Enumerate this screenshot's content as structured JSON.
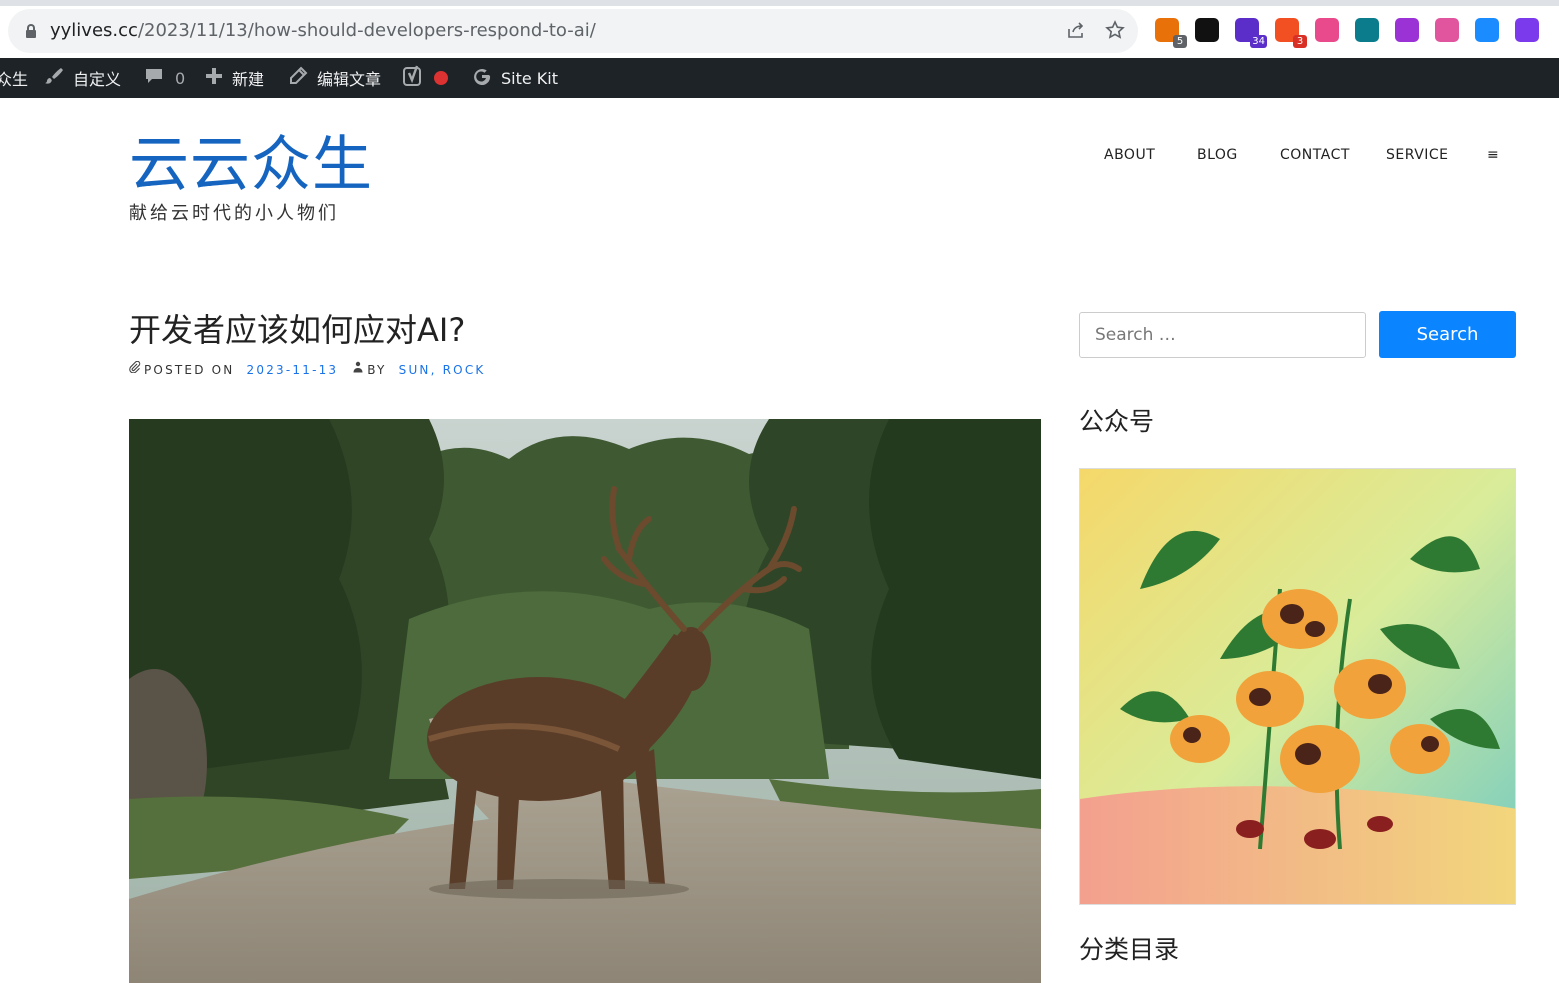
{
  "browser": {
    "url_host": "yylives.cc",
    "url_path": "/2023/11/13/how-should-developers-respond-to-ai/",
    "extensions": [
      {
        "name": "chrome-ext-1-icon",
        "badge": "5",
        "color": "#e8710a",
        "badge_color": "#5f6368"
      },
      {
        "name": "notion-icon",
        "badge": "",
        "color": "#111111",
        "badge_color": ""
      },
      {
        "name": "graduation-cap-icon",
        "badge": "34",
        "color": "#5b2ec9",
        "badge_color": "#5b2ec9"
      },
      {
        "name": "chrome-ext-4-icon",
        "badge": "3",
        "color": "#f25022",
        "badge_color": "#d93025"
      },
      {
        "name": "translate-icon",
        "badge": "",
        "color": "#e84a8b",
        "badge_color": ""
      },
      {
        "name": "chrome-ext-6-icon",
        "badge": "",
        "color": "#0a7c8c",
        "badge_color": ""
      },
      {
        "name": "chrome-ext-7-icon",
        "badge": "",
        "color": "#9b32d6",
        "badge_color": ""
      },
      {
        "name": "chrome-ext-8-icon",
        "badge": "",
        "color": "#e0559d",
        "badge_color": ""
      },
      {
        "name": "chrome-ext-9-icon",
        "badge": "",
        "color": "#1a8cff",
        "badge_color": ""
      },
      {
        "name": "openai-icon",
        "badge": "",
        "color": "#7c3aed",
        "badge_color": ""
      }
    ]
  },
  "adminbar": {
    "site_name": "众生",
    "customize": "自定义",
    "comments_count": "0",
    "new": "新建",
    "edit_post": "编辑文章",
    "site_kit": "Site Kit"
  },
  "site": {
    "title": "云云众生",
    "description": "献给云时代的小人物们"
  },
  "nav": {
    "items": [
      "ABOUT",
      "BLOG",
      "CONTACT",
      "SERVICE"
    ],
    "menu_toggle": "≡"
  },
  "post": {
    "title": "开发者应该如何应对AI?",
    "posted_on_label": "POSTED ON",
    "date": "2023-11-13",
    "by_label": "BY",
    "author": "SUN, ROCK",
    "featured_image": "elk-standing-on-dirt-road-forest"
  },
  "sidebar": {
    "search_placeholder": "Search …",
    "search_button": "Search",
    "widget1_title": "公众号",
    "widget1_image": "cartoon-ants-and-plants-illustration",
    "widget2_title": "分类目录"
  },
  "colors": {
    "accent": "#1565c0",
    "link": "#1a73e8",
    "button": "#0a84ff",
    "adminbar": "#1d2327"
  }
}
